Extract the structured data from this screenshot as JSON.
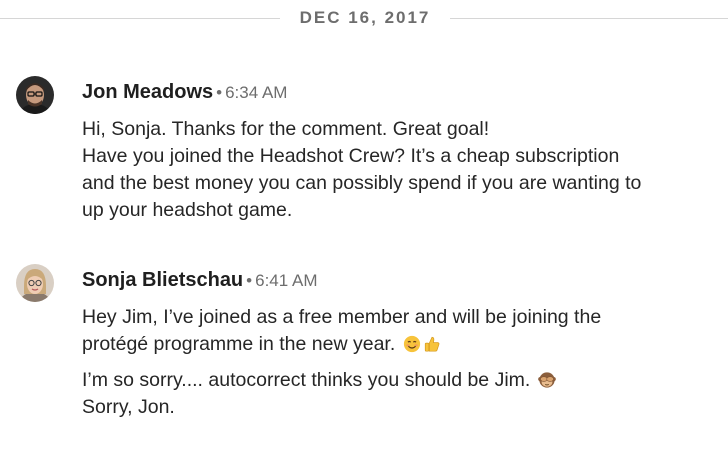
{
  "date_divider": "DEC 16, 2017",
  "messages": [
    {
      "sender": "Jon Meadows",
      "separator": "•",
      "time": "6:34 AM",
      "lines": [
        "Hi, Sonja. Thanks for the comment. Great goal!",
        "Have you joined the Headshot Crew? It’s a cheap subscription",
        "and the best money you can possibly spend if you are wanting to",
        "up your headshot game."
      ]
    },
    {
      "sender": "Sonja Blietschau",
      "separator": "•",
      "time": "6:41 AM",
      "lines": [
        "Hey Jim, I’ve joined as a free member and will be joining the",
        "protégé programme in the new year.",
        "I’m so sorry.... autocorrect thinks you should be Jim.",
        "Sorry, Jon."
      ],
      "emojis": [
        "smiling-face-emoji",
        "thumbs-up-emoji",
        "see-no-evil-monkey-emoji"
      ]
    }
  ]
}
